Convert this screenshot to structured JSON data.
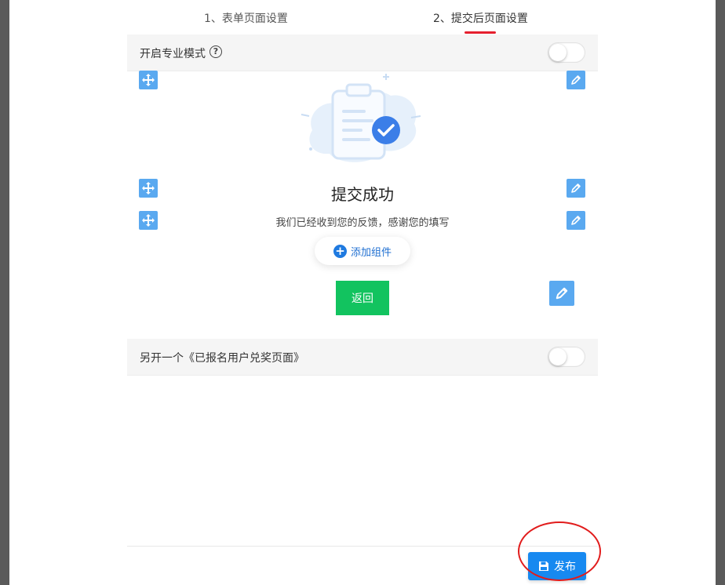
{
  "tabs": [
    {
      "label": "1、表单页面设置"
    },
    {
      "label": "2、提交后页面设置"
    }
  ],
  "pro_mode": {
    "label": "开启专业模式",
    "help_icon": "?",
    "enabled": false
  },
  "success": {
    "title": "提交成功",
    "description": "我们已经收到您的反馈，感谢您的填写"
  },
  "add_component": {
    "label": "添加组件"
  },
  "return_button": {
    "label": "返回"
  },
  "redeem_page": {
    "label": "另开一个《已报名用户兑奖页面》",
    "enabled": false
  },
  "publish_button": {
    "label": "发布"
  },
  "icons": {
    "move": "move-arrows-icon",
    "edit": "pencil-icon",
    "plus": "plus-circle-icon",
    "save": "floppy-disk-icon",
    "illustration": "clipboard-check-illustration"
  },
  "colors": {
    "accent_blue": "#1789f0",
    "tool_blue": "#5aa9f0",
    "green": "#12c35f",
    "tab_underline": "#e5202e",
    "annotation_red": "#e11c1c"
  }
}
